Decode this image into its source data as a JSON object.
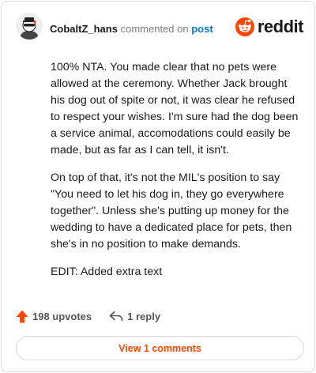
{
  "header": {
    "username": "CobaltZ_hans",
    "action": "commented on",
    "post_link": "post",
    "logo_text": "reddit"
  },
  "comment": {
    "paragraphs": [
      "100% NTA. You made clear that no pets were allowed at the ceremony. Whether Jack brought his dog out of spite or not, it was clear he refused to respect your wishes. I'm sure had the dog been a service animal, accomodations could easily be made, but as far as I can tell, it isn't.",
      "On top of that, it's not the MIL's position to say \"You need to let his dog in, they go everywhere together\". Unless she's putting up money for the wedding to have a dedicated place for pets, then she's in no position to make demands.",
      "EDIT: Added extra text"
    ]
  },
  "footer": {
    "upvotes": "198 upvotes",
    "replies": "1 reply",
    "view_comments": "View 1 comments"
  },
  "colors": {
    "accent": "#ff4500",
    "link": "#0079d3",
    "muted": "#7c7c7c"
  },
  "icons": [
    "avatar",
    "reddit-logo-icon",
    "upvote-arrow-icon",
    "reply-arrow-icon"
  ]
}
